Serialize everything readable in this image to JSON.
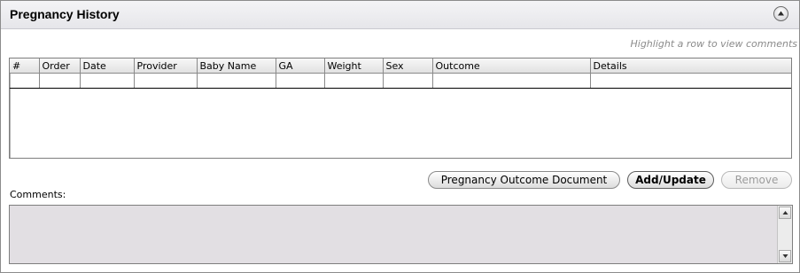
{
  "header": {
    "title": "Pregnancy History",
    "collapse_icon": "chevron-up-circle-icon"
  },
  "hint": "Highlight a row to view comments",
  "grid": {
    "columns": [
      "#",
      "Order",
      "Date",
      "Provider",
      "Baby Name",
      "GA",
      "Weight",
      "Sex",
      "Outcome",
      "Details"
    ],
    "rows": []
  },
  "buttons": {
    "outcome_document": "Pregnancy Outcome Document",
    "add_update": "Add/Update",
    "remove": "Remove"
  },
  "comments": {
    "label": "Comments:",
    "value": ""
  }
}
